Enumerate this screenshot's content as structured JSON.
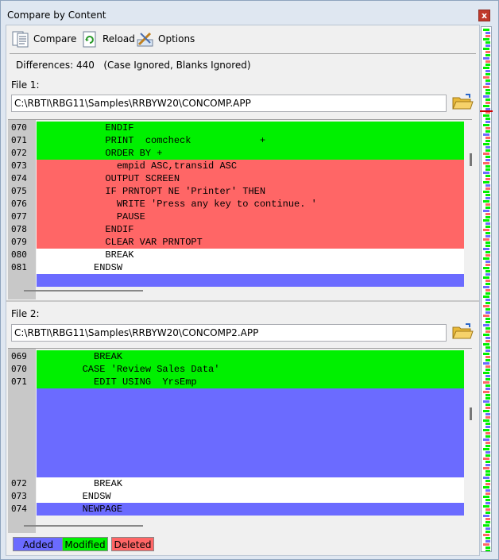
{
  "window": {
    "title": "Compare by Content",
    "close_glyph": "x"
  },
  "toolbar": [
    {
      "label": "Compare",
      "icon": "compare-icon"
    },
    {
      "label": "Reload",
      "icon": "reload-icon"
    },
    {
      "label": "Options",
      "icon": "options-icon"
    }
  ],
  "summary": {
    "differences": "Differences: 440",
    "flags": "(Case Ignored, Blanks Ignored)"
  },
  "file1": {
    "label": "File 1:",
    "path": "C:\\RBTI\\RBG11\\Samples\\RRBYW20\\CONCOMP.APP",
    "lines": [
      {
        "num": "070",
        "text": "            ENDIF",
        "status": "modified"
      },
      {
        "num": "071",
        "text": "            PRINT  comcheck            +",
        "status": "modified"
      },
      {
        "num": "072",
        "text": "            ORDER BY +",
        "status": "modified"
      },
      {
        "num": "073",
        "text": "              empid ASC,transid ASC",
        "status": "deleted"
      },
      {
        "num": "074",
        "text": "            OUTPUT SCREEN",
        "status": "deleted"
      },
      {
        "num": "075",
        "text": "            IF PRNTOPT NE 'Printer' THEN",
        "status": "deleted"
      },
      {
        "num": "076",
        "text": "              WRITE 'Press any key to continue. '",
        "status": "deleted"
      },
      {
        "num": "077",
        "text": "              PAUSE",
        "status": "deleted"
      },
      {
        "num": "078",
        "text": "            ENDIF",
        "status": "deleted"
      },
      {
        "num": "079",
        "text": "            CLEAR VAR PRNTOPT",
        "status": "deleted"
      },
      {
        "num": "080",
        "text": "            BREAK",
        "status": "same"
      },
      {
        "num": "081",
        "text": "          ENDSW",
        "status": "same"
      },
      {
        "num": "",
        "text": "",
        "status": "added"
      }
    ]
  },
  "file2": {
    "label": "File 2:",
    "path": "C:\\RBTI\\RBG11\\Samples\\RRBYW20\\CONCOMP2.APP",
    "lines": [
      {
        "num": "069",
        "text": "          BREAK",
        "status": "modified"
      },
      {
        "num": "070",
        "text": "        CASE 'Review Sales Data'",
        "status": "modified"
      },
      {
        "num": "071",
        "text": "          EDIT USING  YrsEmp",
        "status": "modified"
      },
      {
        "num": "",
        "text": "",
        "status": "added"
      },
      {
        "num": "",
        "text": "",
        "status": "added"
      },
      {
        "num": "",
        "text": "",
        "status": "added"
      },
      {
        "num": "",
        "text": "",
        "status": "added"
      },
      {
        "num": "",
        "text": "",
        "status": "added"
      },
      {
        "num": "",
        "text": "",
        "status": "added"
      },
      {
        "num": "",
        "text": "",
        "status": "added"
      },
      {
        "num": "072",
        "text": "          BREAK",
        "status": "same"
      },
      {
        "num": "073",
        "text": "        ENDSW",
        "status": "same"
      },
      {
        "num": "074",
        "text": "        NEWPAGE",
        "status": "added"
      }
    ]
  },
  "legend": [
    {
      "label": "Added",
      "color": "#6b6bff"
    },
    {
      "label": "Modified",
      "color": "#00f000"
    },
    {
      "label": "Deleted",
      "color": "#ff6666"
    }
  ],
  "colors": {
    "added": "#6b6bff",
    "modified": "#00f000",
    "deleted": "#ff6666",
    "same": "#ffffff"
  }
}
